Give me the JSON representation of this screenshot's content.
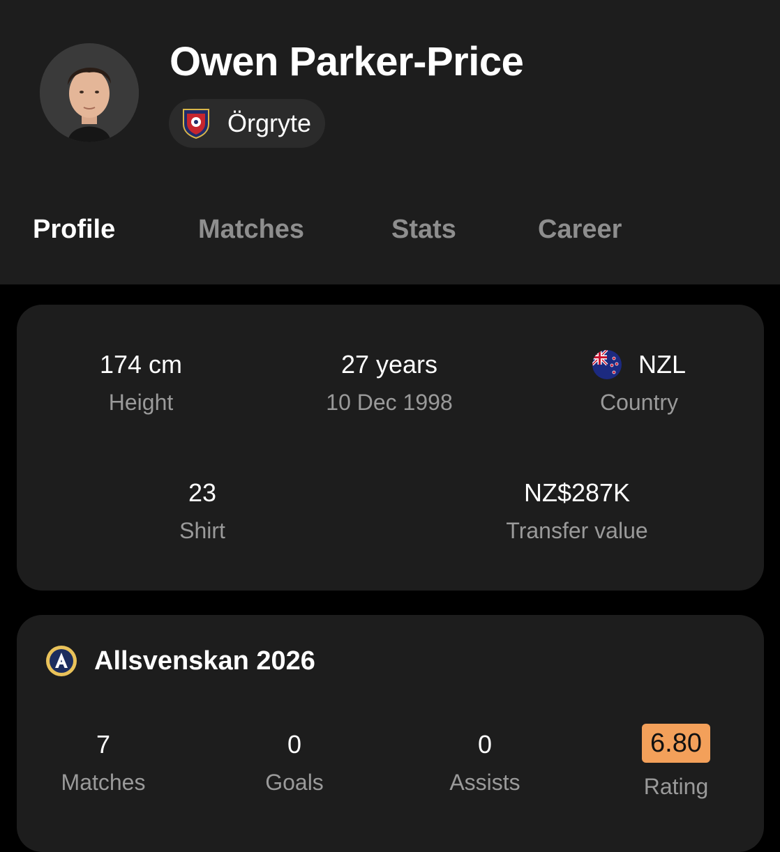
{
  "player": {
    "name": "Owen Parker-Price",
    "team": "Örgryte"
  },
  "tabs": [
    {
      "label": "Profile",
      "active": true
    },
    {
      "label": "Matches",
      "active": false
    },
    {
      "label": "Stats",
      "active": false
    },
    {
      "label": "Career",
      "active": false
    }
  ],
  "profile": {
    "height": {
      "value": "174 cm",
      "label": "Height"
    },
    "age": {
      "value": "27 years",
      "label": "10 Dec 1998"
    },
    "country": {
      "value": "NZL",
      "label": "Country",
      "flag": "new-zealand-flag-icon"
    },
    "shirt": {
      "value": "23",
      "label": "Shirt"
    },
    "transfer": {
      "value": "NZ$287K",
      "label": "Transfer value"
    }
  },
  "league": {
    "title": "Allsvenskan 2026",
    "logo": "allsvenskan-logo-icon",
    "stats": [
      {
        "value": "7",
        "label": "Matches"
      },
      {
        "value": "0",
        "label": "Goals"
      },
      {
        "value": "0",
        "label": "Assists"
      },
      {
        "value": "6.80",
        "label": "Rating"
      }
    ]
  },
  "colors": {
    "header_bg": "#1d1d1d",
    "page_bg": "#000000",
    "card_bg": "#1d1d1d",
    "tab_inactive": "#8e8e8e",
    "label_gray": "#9a9a9a",
    "rating_badge": "#f3a05a"
  }
}
